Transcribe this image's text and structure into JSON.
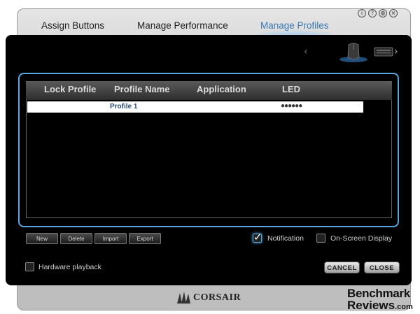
{
  "window_controls": [
    "i",
    "?",
    "globe",
    "x"
  ],
  "tabs": [
    {
      "label": "Assign Buttons",
      "active": false
    },
    {
      "label": "Manage Performance",
      "active": false
    },
    {
      "label": "Manage Profiles",
      "active": true
    }
  ],
  "table": {
    "headers": [
      "Lock Profile",
      "Profile Name",
      "Application",
      "LED"
    ],
    "rows": [
      {
        "lock_profile": "",
        "profile_name": "Profile 1",
        "application": "",
        "led": "●●●●●●"
      }
    ]
  },
  "actions": {
    "new": "New",
    "delete": "Delete",
    "import": "Import",
    "export": "Export"
  },
  "options": {
    "notification": {
      "label": "Notification",
      "checked": true
    },
    "on_screen_display": {
      "label": "On-Screen Display",
      "checked": false
    },
    "hardware_playback": {
      "label": "Hardware playback",
      "checked": false
    }
  },
  "dialog": {
    "cancel": "CANCEL",
    "close": "CLOSE"
  },
  "brand": {
    "name": "CORSAIR"
  },
  "watermark": {
    "line1": "Benchmark",
    "line2": "Reviews",
    "domain": ".com"
  },
  "colors": {
    "accent": "#5aa6e0",
    "active_tab": "#3a78b4",
    "panel": "#000000"
  }
}
